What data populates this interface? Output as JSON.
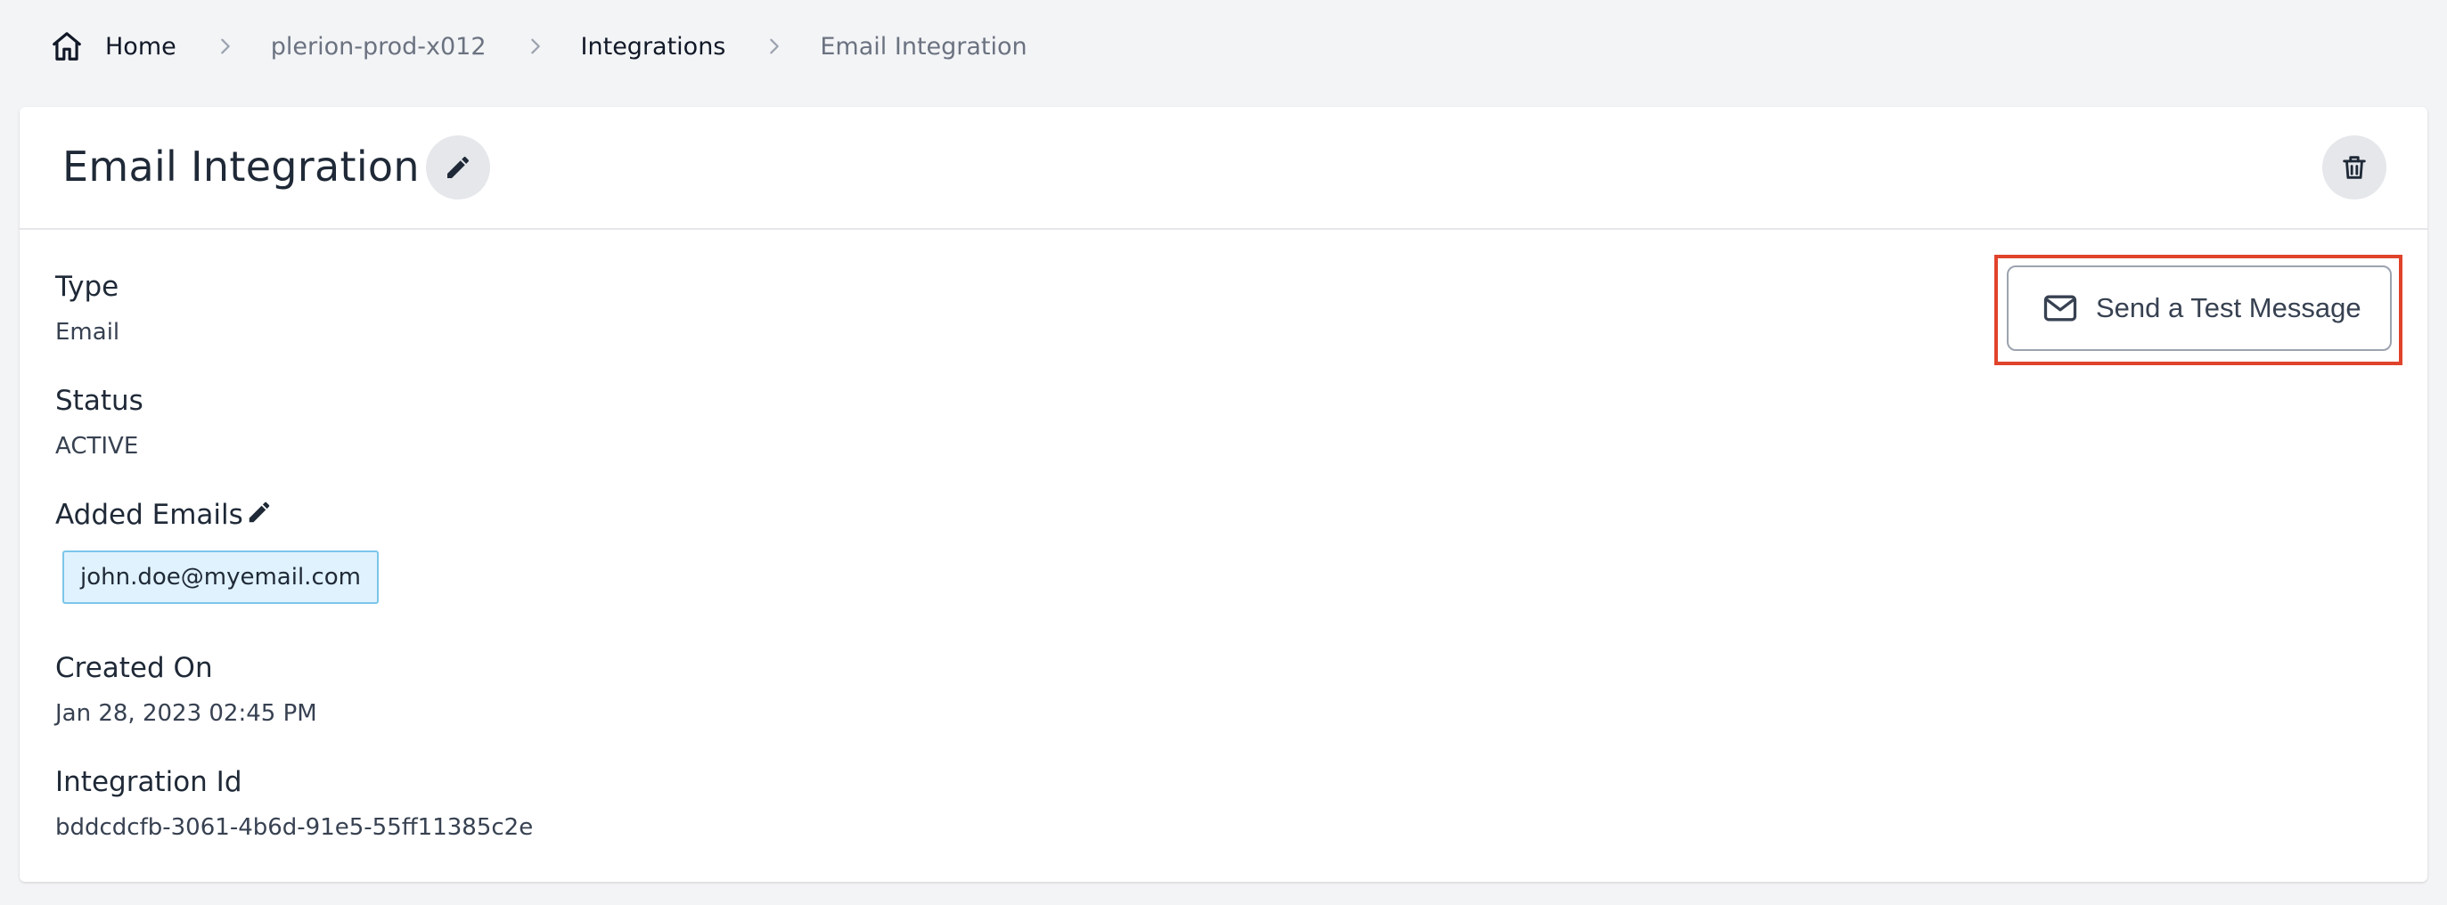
{
  "breadcrumb": {
    "home_label": "Home",
    "items": [
      "plerion-prod-x012",
      "Integrations",
      "Email Integration"
    ]
  },
  "header": {
    "title": "Email Integration",
    "edit_icon": "pencil-icon",
    "delete_icon": "trash-icon"
  },
  "actions": {
    "test_message_label": "Send a Test Message",
    "test_message_icon": "mail-icon",
    "highlight_color": "#e0432b"
  },
  "details": {
    "type_label": "Type",
    "type_value": "Email",
    "status_label": "Status",
    "status_value": "ACTIVE",
    "emails_label": "Added Emails",
    "emails": [
      "john.doe@myemail.com"
    ],
    "created_label": "Created On",
    "created_value": "Jan 28, 2023 02:45 PM",
    "id_label": "Integration Id",
    "id_value": "bddcdcfb-3061-4b6d-91e5-55ff11385c2e"
  },
  "colors": {
    "page_bg": "#f3f4f6",
    "chip_bg": "#e0f2fe",
    "chip_border": "#7cc6ea"
  }
}
